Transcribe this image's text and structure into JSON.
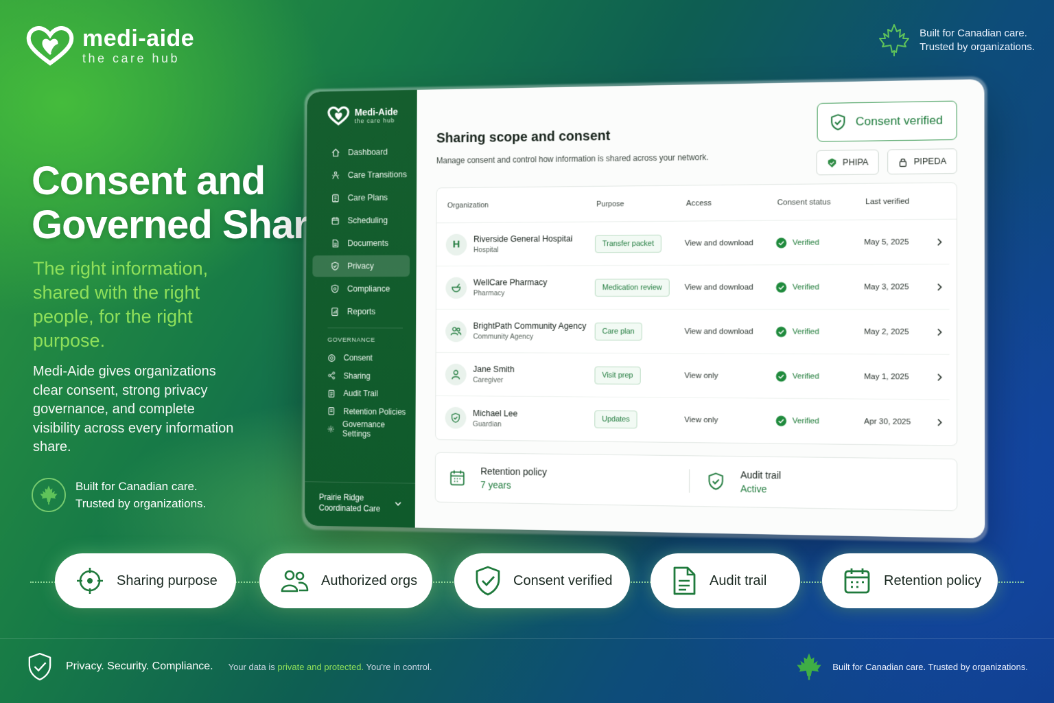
{
  "brand": {
    "name": "medi-aide",
    "tagline": "the care hub"
  },
  "top_right": {
    "line1": "Built for Canadian care.",
    "line2": "Trusted by organizations."
  },
  "hero": {
    "title_line1": "Consent and",
    "title_line2": "Governed Sharing",
    "tagline": "The right information, shared with the right people, for the right purpose.",
    "description": "Medi-Aide gives organizations clear consent, strong privacy governance, and complete visibility across every information share.",
    "badge_line1": "Built for Canadian care.",
    "badge_line2": "Trusted by organizations."
  },
  "app": {
    "sidebar": {
      "brand_name": "Medi-Aide",
      "brand_sub": "the care hub",
      "nav": [
        {
          "label": "Dashboard",
          "icon": "home-icon"
        },
        {
          "label": "Care Transitions",
          "icon": "transitions-icon"
        },
        {
          "label": "Care Plans",
          "icon": "clipboard-icon"
        },
        {
          "label": "Scheduling",
          "icon": "calendar-icon"
        },
        {
          "label": "Documents",
          "icon": "document-icon"
        },
        {
          "label": "Privacy",
          "icon": "shield-icon",
          "active": true
        },
        {
          "label": "Compliance",
          "icon": "shield-check-icon"
        },
        {
          "label": "Reports",
          "icon": "report-icon"
        }
      ],
      "governance_label": "GOVERNANCE",
      "governance": [
        {
          "label": "Consent",
          "icon": "consent-icon"
        },
        {
          "label": "Sharing",
          "icon": "share-icon"
        },
        {
          "label": "Audit Trail",
          "icon": "audit-icon"
        },
        {
          "label": "Retention Policies",
          "icon": "retention-icon"
        },
        {
          "label": "Governance Settings",
          "icon": "gear-icon"
        }
      ],
      "org_line1": "Prairie Ridge",
      "org_line2": "Coordinated Care"
    },
    "main": {
      "title": "Sharing scope and consent",
      "subtitle": "Manage consent and control how information is shared across your network.",
      "consent_badge": "Consent verified",
      "pill_phipa": "PHIPA",
      "pill_pipeda": "PIPEDA",
      "columns": [
        "Organization",
        "Purpose",
        "Access",
        "Consent status",
        "Last verified"
      ],
      "rows": [
        {
          "name": "Riverside General Hospital",
          "type": "Hospital",
          "avatar": "H",
          "purpose": "Transfer packet",
          "access": "View and download",
          "status": "Verified",
          "date": "May 5, 2025"
        },
        {
          "name": "WellCare Pharmacy",
          "type": "Pharmacy",
          "avatar": "",
          "purpose": "Medication review",
          "access": "View and download",
          "status": "Verified",
          "date": "May 3, 2025"
        },
        {
          "name": "BrightPath Community Agency",
          "type": "Community Agency",
          "avatar": "",
          "purpose": "Care plan",
          "access": "View and download",
          "status": "Verified",
          "date": "May 2, 2025"
        },
        {
          "name": "Jane Smith",
          "type": "Caregiver",
          "avatar": "",
          "purpose": "Visit prep",
          "access": "View only",
          "status": "Verified",
          "date": "May 1, 2025"
        },
        {
          "name": "Michael Lee",
          "type": "Guardian",
          "avatar": "",
          "purpose": "Updates",
          "access": "View only",
          "status": "Verified",
          "date": "Apr 30, 2025"
        }
      ],
      "retention_title": "Retention policy",
      "retention_value": "7 years",
      "audit_title": "Audit trail",
      "audit_value": "Active"
    }
  },
  "features": [
    "Sharing purpose",
    "Authorized orgs",
    "Consent verified",
    "Audit trail",
    "Retention policy"
  ],
  "footer": {
    "headline": "Privacy. Security. Compliance.",
    "text_before": "Your data is",
    "text_highlight": "private and protected.",
    "text_after": "You're in control.",
    "right": "Built for Canadian care. Trusted by organizations."
  },
  "colors": {
    "accent_green": "#1f7a3c",
    "highlight_green": "#8fe05a",
    "sidebar_green": "#155e2e"
  }
}
